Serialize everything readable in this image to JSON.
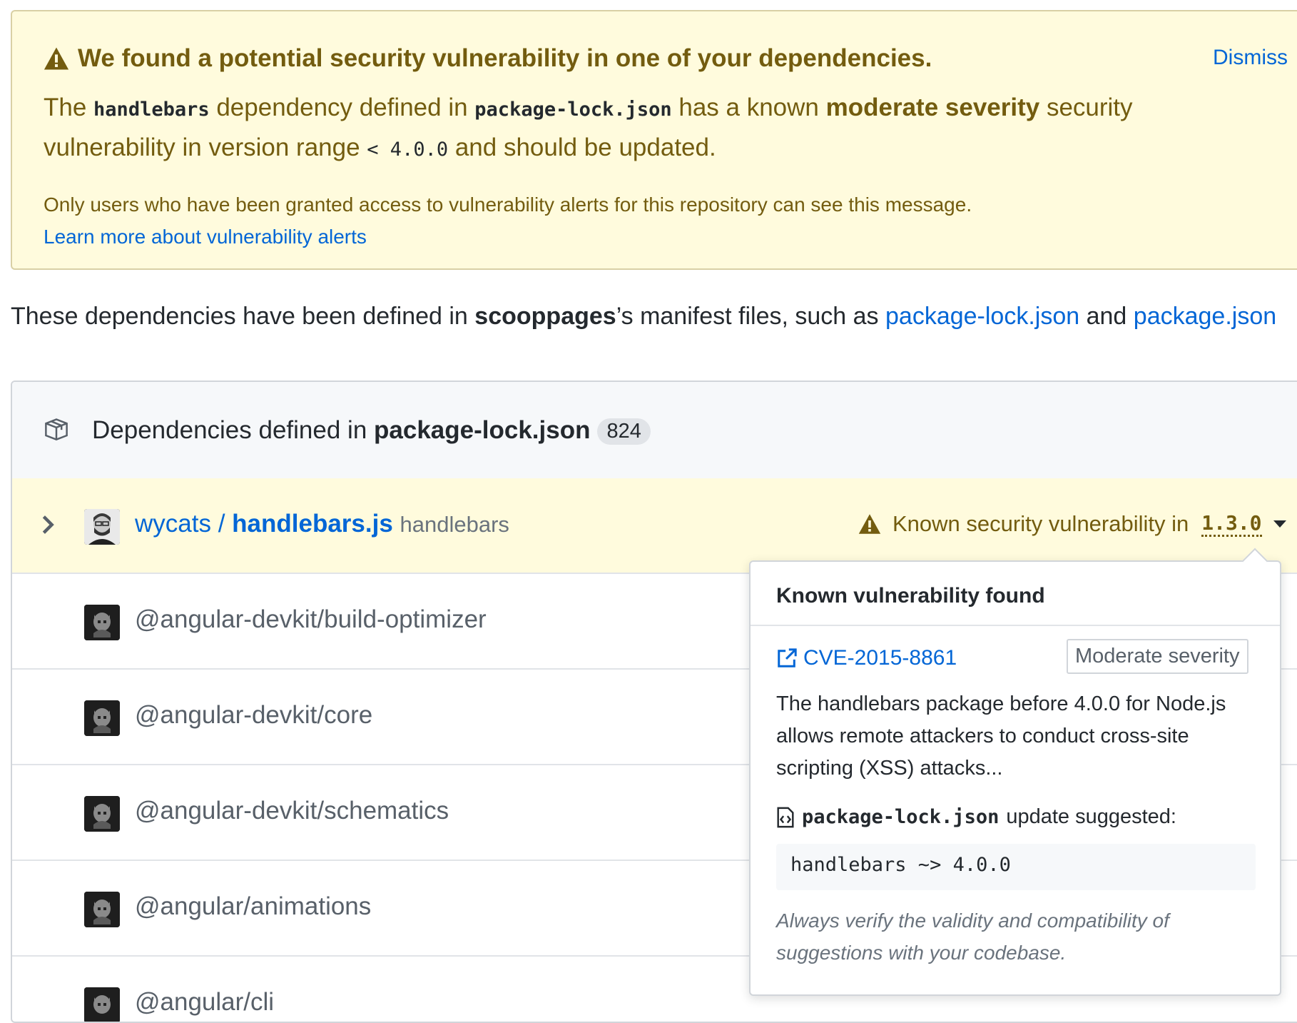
{
  "alert": {
    "title": "We found a potential security vulnerability in one of your dependencies.",
    "dismiss_label": "Dismiss",
    "body_the": "The ",
    "body_package": "handlebars",
    "body_defined_in": " dependency defined in ",
    "body_file": "package-lock.json",
    "body_has_known": " has a known ",
    "body_severity": "moderate severity",
    "body_vuln_range": " security vulnerability in version range ",
    "body_range": "< 4.0.0",
    "body_tail": " and should be updated.",
    "note": "Only users who have been granted access to vulnerability alerts for this repository can see this message.",
    "learn_more": "Learn more about vulnerability alerts"
  },
  "manifest": {
    "prefix": "These dependencies have been defined in ",
    "repo": "scooppages",
    "middle": "’s manifest files, such as ",
    "file1": "package-lock.json",
    "and": " and ",
    "file2": "package.json"
  },
  "deps": {
    "header_prefix": "Dependencies defined in ",
    "header_file": "package-lock.json",
    "count": "824",
    "vuln_row": {
      "owner": "wycats",
      "sep": " / ",
      "repo": "handlebars.js",
      "package": "handlebars",
      "status": "Known security vulnerability in",
      "version": "1.3.0"
    },
    "rows": [
      {
        "name": "@angular-devkit/build-optimizer"
      },
      {
        "name": "@angular-devkit/core"
      },
      {
        "name": "@angular-devkit/schematics"
      },
      {
        "name": "@angular/animations"
      },
      {
        "name": "@angular/cli"
      }
    ]
  },
  "popover": {
    "title": "Known vulnerability found",
    "cve": "CVE-2015-8861",
    "severity": "Moderate severity",
    "description": "The handlebars package before 4.0.0 for Node.js allows remote attackers to conduct cross-site scripting (XSS) attacks...",
    "suggest_file": "package-lock.json",
    "suggest_text": "update suggested:",
    "code": "handlebars ~> 4.0.0",
    "note": "Always verify the validity and compatibility of suggestions with your codebase."
  },
  "colors": {
    "link": "#0366d6",
    "warning_text": "#735c0f",
    "warning_bg": "#fffbdd"
  },
  "icons": [
    "alert-icon",
    "package-icon",
    "chevron-right-icon",
    "triangle-down-icon",
    "link-external-icon",
    "file-code-icon"
  ]
}
